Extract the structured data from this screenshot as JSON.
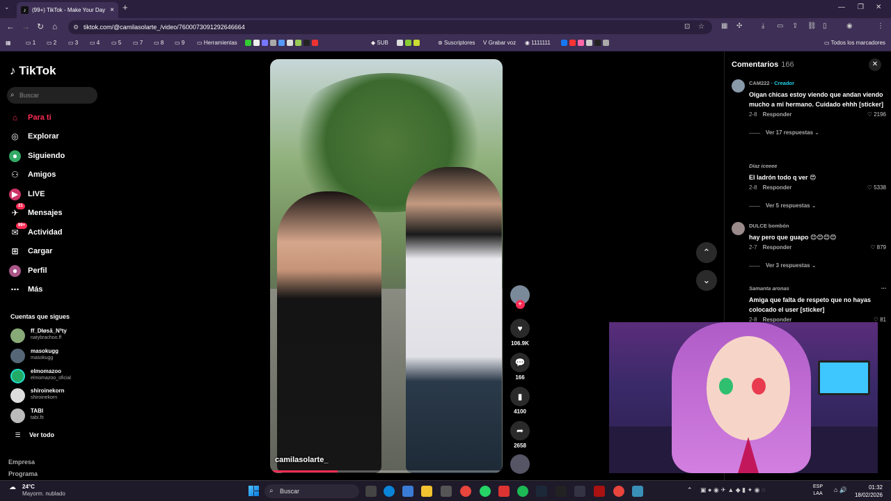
{
  "browser": {
    "tab_title": "(99+) TikTok - Make Your Day",
    "url": "tiktok.com/@camilasolarte_/video/7600073091292646664",
    "bookmarks": [
      "1",
      "2",
      "3",
      "4",
      "5",
      "7",
      "8",
      "9",
      "Herramientas",
      "SUB",
      "Suscriptores",
      "Grabar voz",
      "1111111"
    ],
    "all_bookmarks": "Todos los marcadores"
  },
  "sidebar": {
    "logo": "TikTok",
    "search_placeholder": "Buscar",
    "nav": [
      {
        "label": "Para ti",
        "icon": "home-icon"
      },
      {
        "label": "Explorar",
        "icon": "compass-icon"
      },
      {
        "label": "Siguiendo",
        "icon": "following-icon"
      },
      {
        "label": "Amigos",
        "icon": "friends-icon"
      },
      {
        "label": "LIVE",
        "icon": "live-icon"
      },
      {
        "label": "Mensajes",
        "icon": "messages-icon",
        "badge": "21"
      },
      {
        "label": "Actividad",
        "icon": "activity-icon",
        "badge": "99+"
      },
      {
        "label": "Cargar",
        "icon": "upload-icon"
      },
      {
        "label": "Perfil",
        "icon": "profile-icon"
      },
      {
        "label": "Más",
        "icon": "more-icon"
      }
    ],
    "following_title": "Cuentas que sigues",
    "following": [
      {
        "name": "ff_Dłøsă_Nªty",
        "handle": "natybrachoo.ff"
      },
      {
        "name": "masokugg",
        "handle": "masokugg"
      },
      {
        "name": "elmomazoo",
        "handle": "elmomazoo_oficial"
      },
      {
        "name": "shiroinekorn",
        "handle": "shiroinekorn"
      },
      {
        "name": "TABI",
        "handle": "tabi.fit"
      }
    ],
    "see_all": "Ver todo",
    "footer": [
      "Empresa",
      "Programa"
    ]
  },
  "video": {
    "username": "camilasolarte_",
    "progress": 0.29,
    "likes": "106.9K",
    "comments": "166",
    "saves": "4100",
    "shares": "2658"
  },
  "comments": {
    "title": "Comentarios",
    "count": "166",
    "items": [
      {
        "user": "CAM222",
        "creator": "· Creador",
        "text": "Oigan chicas estoy viendo que andan viendo mucho a mi hermano. Cuidado ehhh [sticker]",
        "date": "2-8",
        "reply": "Responder",
        "likes": "2196",
        "more": "Ver 17 respuestas"
      },
      {
        "user": "Díaz iceeee",
        "creator": "",
        "text": "El ladrón todo q ver 😍",
        "date": "2-8",
        "reply": "Responder",
        "likes": "5338",
        "more": "Ver 5 respuestas"
      },
      {
        "user": "DULCE bombón",
        "creator": "",
        "text": "hay pero que guapo 😊😊😊😊",
        "date": "2-7",
        "reply": "Responder",
        "likes": "879",
        "more": "Ver 3 respuestas"
      },
      {
        "user": "Samanta aronas",
        "creator": "",
        "text": "Amiga que falta de respeto que no hayas colocado el user [sticker]",
        "date": "2-8",
        "reply": "Responder",
        "likes": "81",
        "more": ""
      }
    ]
  },
  "taskbar": {
    "temp": "24°C",
    "weather": "Mayorm. nublado",
    "search": "Buscar",
    "lang": "ESP",
    "lang2": "LAA",
    "time": "01:32",
    "date": "18/02/2026"
  },
  "colors": {
    "accent": "#fe2c55",
    "creator": "#20d5ec"
  }
}
